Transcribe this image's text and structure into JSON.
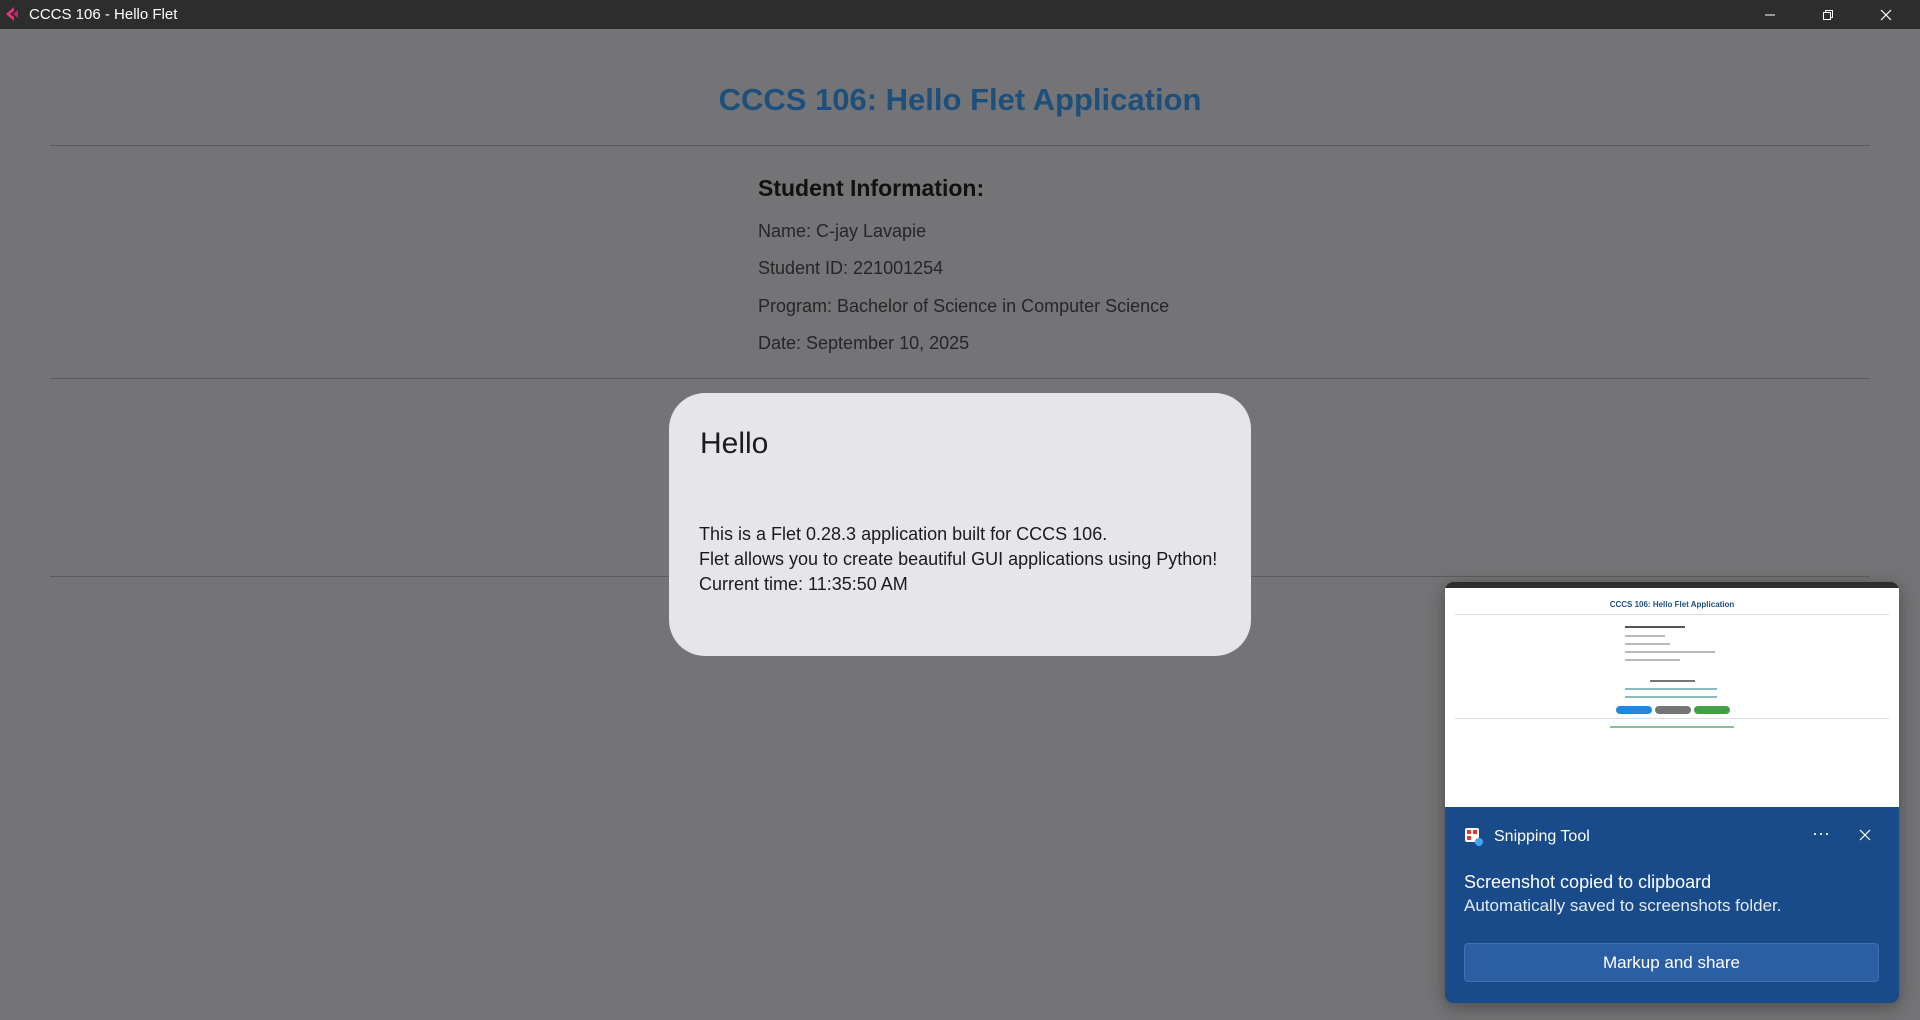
{
  "window": {
    "title": "CCCS 106 - Hello Flet",
    "accent": "#e8317f"
  },
  "page": {
    "app_title": "CCCS 106: Hello Flet Application",
    "student_info": {
      "heading": "Student Information:",
      "name": "Name: C-jay Lavapie",
      "student_id": "Student ID: 221001254",
      "program": "Program: Bachelor of Science in Computer Science",
      "date": "Date: September 10, 2025"
    }
  },
  "dialog": {
    "title": "Hello",
    "line1": "This is a Flet 0.28.3 application built for CCCS 106.",
    "line2": "Flet allows you to create beautiful GUI applications using Python!",
    "line3": "Current time: 11:35:50 AM"
  },
  "toast": {
    "thumbnail_title": "CCCS 106: Hello Flet Application",
    "app_name": "Snipping Tool",
    "more_label": "···",
    "message": "Screenshot copied to clipboard",
    "detail": "Automatically saved to screenshots folder.",
    "action_label": "Markup and share",
    "background": "#194a8a"
  },
  "icons": {
    "app": "flet-logo-icon",
    "minimize": "minimize-icon",
    "maximize": "restore-icon",
    "close": "close-icon",
    "snipping": "snipping-tool-icon"
  }
}
